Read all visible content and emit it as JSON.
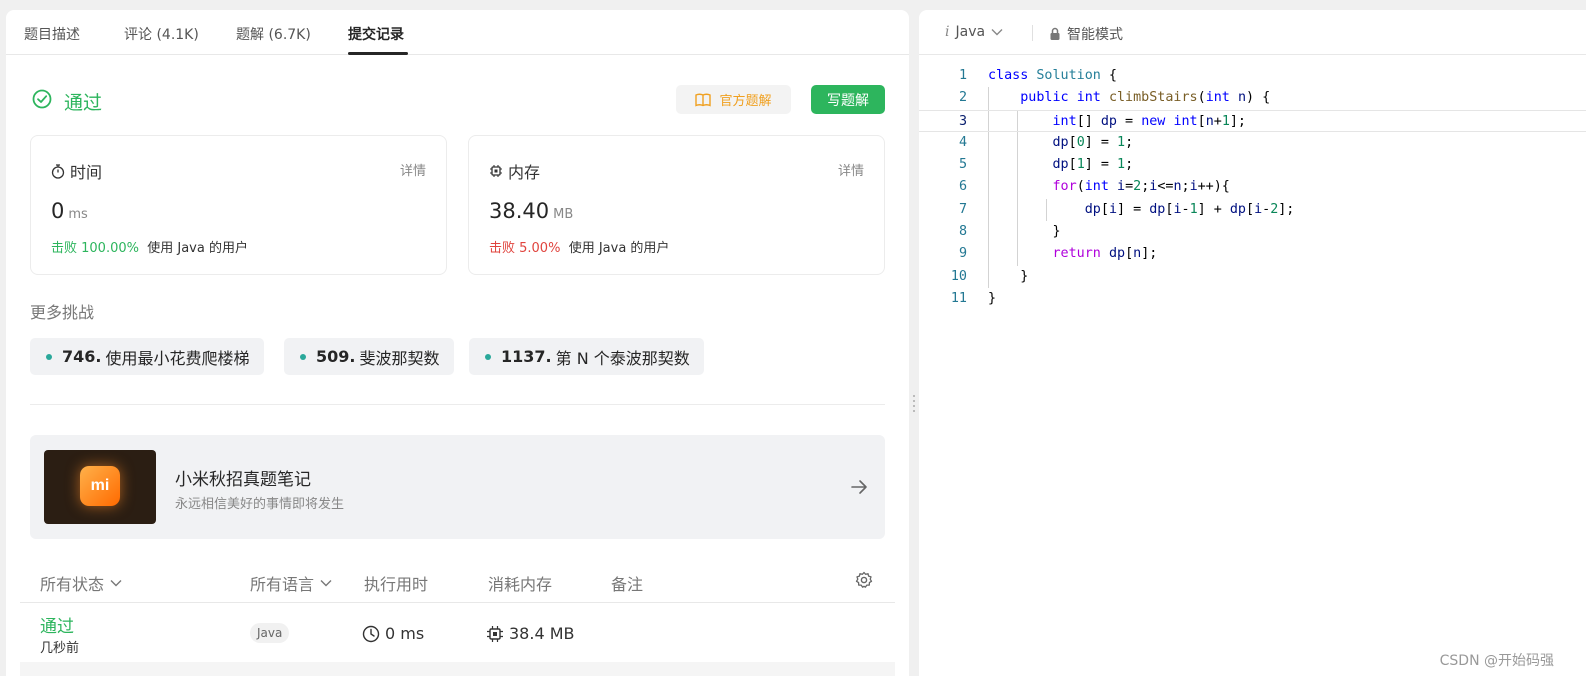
{
  "tabs": [
    {
      "label": "题目描述"
    },
    {
      "label": "评论 (4.1K)"
    },
    {
      "label": "题解 (6.7K)"
    },
    {
      "label": "提交记录"
    }
  ],
  "result": {
    "status": "通过",
    "official_btn": "官方题解",
    "write_btn": "写题解"
  },
  "stats": {
    "time": {
      "title": "时间",
      "detail": "详情",
      "value": "0",
      "unit": "ms",
      "beat": "击败 100.00%",
      "suffix": "使用 Java 的用户"
    },
    "memory": {
      "title": "内存",
      "detail": "详情",
      "value": "38.40",
      "unit": "MB",
      "beat": "击败 5.00%",
      "suffix": "使用 Java 的用户"
    }
  },
  "more": {
    "title": "更多挑战",
    "items": [
      {
        "num": "746.",
        "name": "使用最小花费爬楼梯"
      },
      {
        "num": "509.",
        "name": "斐波那契数"
      },
      {
        "num": "1137.",
        "name": "第 N 个泰波那契数"
      }
    ]
  },
  "promo": {
    "logo": "mi",
    "title": "小米秋招真题笔记",
    "subtitle": "永远相信美好的事情即将发生"
  },
  "table": {
    "headers": {
      "status": "所有状态",
      "lang": "所有语言",
      "runtime": "执行用时",
      "memory": "消耗内存",
      "note": "备注"
    },
    "rows": [
      {
        "status": "通过",
        "time": "几秒前",
        "lang": "Java",
        "runtime": "0 ms",
        "memory": "38.4 MB"
      }
    ]
  },
  "editor": {
    "language": "Java",
    "mode": "智能模式",
    "current_line": 3,
    "lines": [
      "class Solution {",
      "    public int climbStairs(int n) {",
      "        int[] dp = new int[n+1];",
      "        dp[0] = 1;",
      "        dp[1] = 1;",
      "        for(int i=2;i<=n;i++){",
      "            dp[i] = dp[i-1] + dp[i-2];",
      "        }",
      "        return dp[n];",
      "    }",
      "}"
    ]
  },
  "watermark": "CSDN @开始码强",
  "colors": {
    "success": "#2db55d",
    "danger": "#e0443e",
    "official": "#f0a020"
  }
}
